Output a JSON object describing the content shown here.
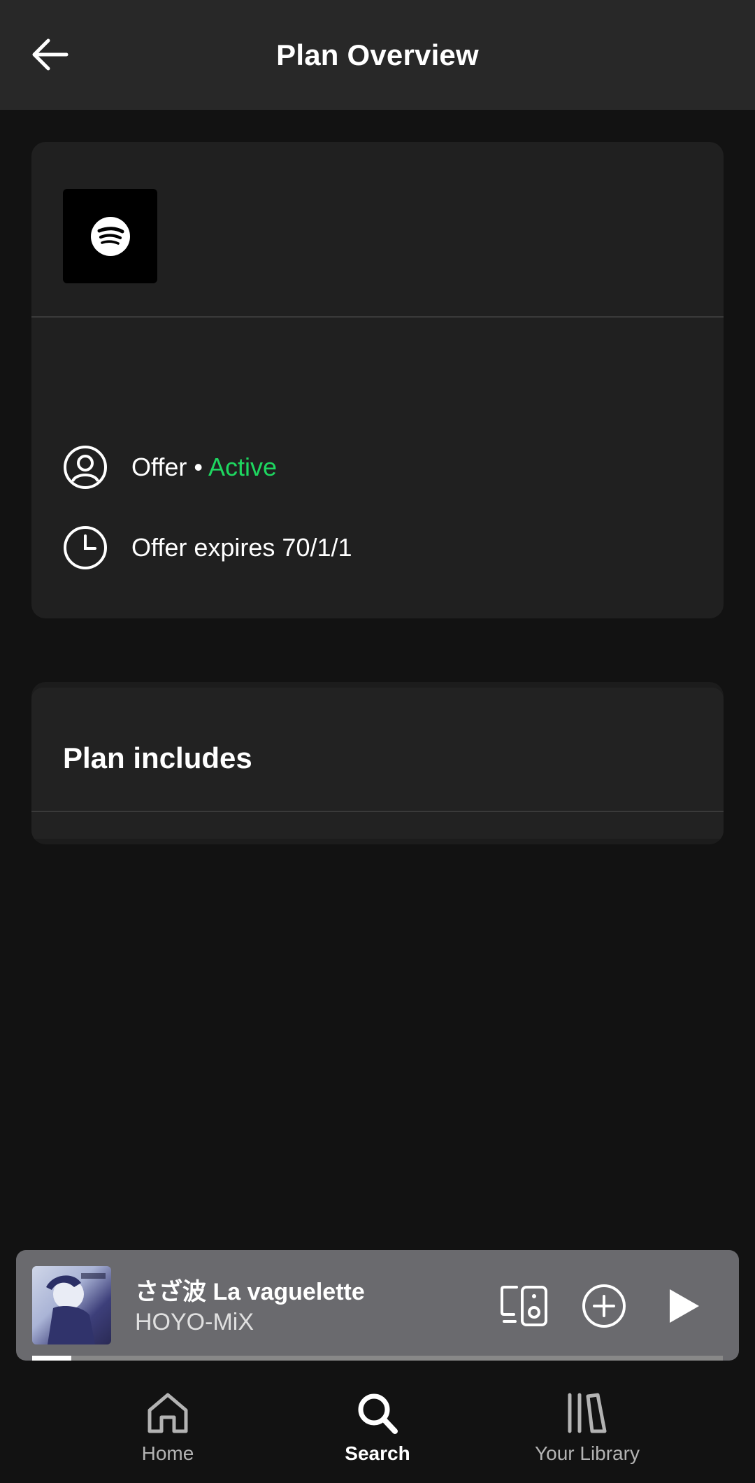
{
  "header": {
    "title": "Plan Overview",
    "back_icon": "arrow-left-icon"
  },
  "plan_card": {
    "logo_icon": "spotify-logo-icon",
    "status_prefix": "Offer • ",
    "status_value": "Active",
    "expiry_text": "Offer expires 70/1/1"
  },
  "plan_includes": {
    "title": "Plan includes"
  },
  "mini_player": {
    "track_title": "さざ波 La vaguelette",
    "artist": "HOYO-MiX",
    "progress": 0.057
  },
  "bottom_nav": {
    "items": [
      {
        "label": "Home",
        "icon": "home-icon",
        "selected": false
      },
      {
        "label": "Search",
        "icon": "search-icon",
        "selected": true
      },
      {
        "label": "Your Library",
        "icon": "library-icon",
        "selected": false
      }
    ]
  },
  "colors": {
    "accent": "#1ed760",
    "background": "#121212",
    "card": "#202020"
  }
}
